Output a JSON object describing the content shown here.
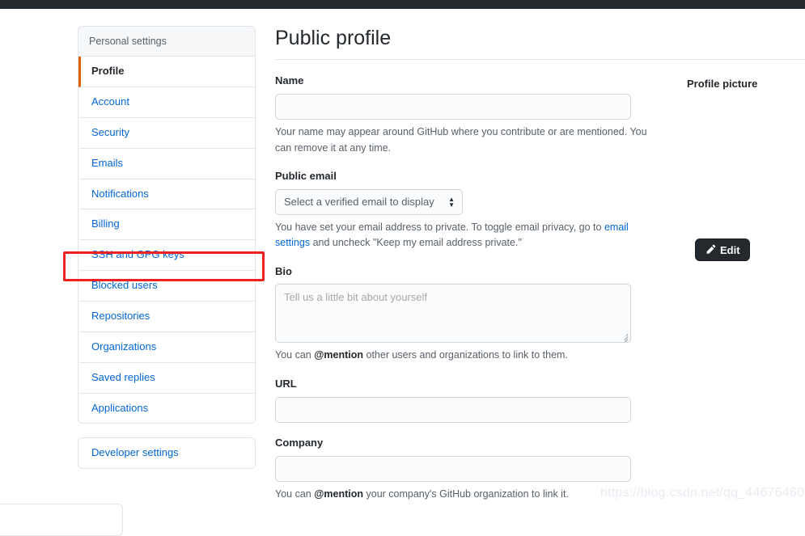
{
  "window": {
    "topbar_color": "#24292e"
  },
  "sidebar": {
    "header": "Personal settings",
    "items": [
      {
        "label": "Profile",
        "active": true
      },
      {
        "label": "Account",
        "active": false
      },
      {
        "label": "Security",
        "active": false
      },
      {
        "label": "Emails",
        "active": false
      },
      {
        "label": "Notifications",
        "active": false
      },
      {
        "label": "Billing",
        "active": false
      },
      {
        "label": "SSH and GPG keys",
        "active": false
      },
      {
        "label": "Blocked users",
        "active": false
      },
      {
        "label": "Repositories",
        "active": false
      },
      {
        "label": "Organizations",
        "active": false
      },
      {
        "label": "Saved replies",
        "active": false
      },
      {
        "label": "Applications",
        "active": false
      }
    ],
    "developer_settings": "Developer settings",
    "active_accent_color": "#e36209",
    "link_color": "#0366d6"
  },
  "annotation": {
    "target": "SSH and GPG keys",
    "color": "#ee2222"
  },
  "main": {
    "title": "Public profile",
    "name": {
      "label": "Name",
      "value": "",
      "placeholder": "",
      "help": "Your name may appear around GitHub where you contribute or are mentioned. You can remove it at any time."
    },
    "public_email": {
      "label": "Public email",
      "selected": "Select a verified email to display",
      "help_before": "You have set your email address to private. To toggle email privacy, go to ",
      "help_link": "email settings",
      "help_after": " and uncheck \"Keep my email address private.\""
    },
    "bio": {
      "label": "Bio",
      "value": "",
      "placeholder": "Tell us a little bit about yourself",
      "help_before": "You can ",
      "help_mention": "@mention",
      "help_after": " other users and organizations to link to them."
    },
    "url": {
      "label": "URL",
      "value": "",
      "placeholder": ""
    },
    "company": {
      "label": "Company",
      "value": "",
      "placeholder": "",
      "help_before": "You can ",
      "help_mention": "@mention",
      "help_after": " your company's GitHub organization to link it."
    }
  },
  "right_rail": {
    "title": "Profile picture",
    "edit_button": "Edit"
  },
  "watermark": "https://blog.csdn.net/qq_44676460"
}
